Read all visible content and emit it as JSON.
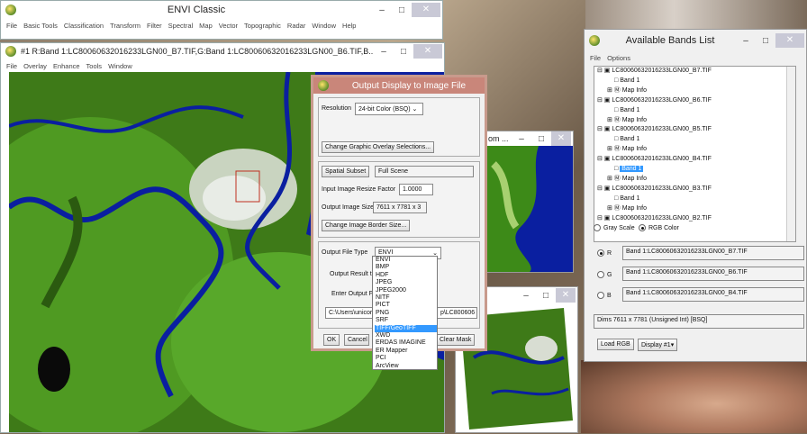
{
  "envi": {
    "title": "ENVI Classic",
    "menu": [
      "File",
      "Basic Tools",
      "Classification",
      "Transform",
      "Filter",
      "Spectral",
      "Map",
      "Vector",
      "Topographic",
      "Radar",
      "Window",
      "Help"
    ]
  },
  "display": {
    "title": "#1 R:Band 1:LC80060632016233LGN00_B7.TIF,G:Band 1:LC80060632016233LGN00_B6.TIF,B...",
    "menu": [
      "File",
      "Overlay",
      "Enhance",
      "Tools",
      "Window"
    ]
  },
  "dialog": {
    "title": "Output Display to Image File",
    "resolution_label": "Resolution",
    "resolution_value": "24-bit Color (BSQ)",
    "overlay_button": "Change Graphic Overlay Selections...",
    "spatial_subset_button": "Spatial Subset",
    "spatial_subset_value": "Full Scene",
    "resize_label": "Input Image Resize Factor",
    "resize_value": "1.0000",
    "size_label": "Output Image Size",
    "size_value": "7611 x 7781 x 3",
    "border_button": "Change Image Border Size...",
    "file_type_label": "Output File Type",
    "file_type_value": "ENVI",
    "output_result_label": "Output Result to",
    "enter_output_label": "Enter Output Fil",
    "path_left": "C:\\Users\\unicor",
    "path_right": "p\\LC800606",
    "ok": "OK",
    "cancel": "Cancel",
    "clear_mask": "Clear Mask",
    "file_types": [
      "ENVI",
      "BMP",
      "HDF",
      "JPEG",
      "JPEG2000",
      "NITF",
      "PICT",
      "PNG",
      "SRF",
      "TIFF/GeoTIFF",
      "XWD",
      "ERDAS IMAGINE",
      "ER Mapper",
      "PCI",
      "ArcView"
    ],
    "file_type_selected_index": 9
  },
  "zoom_window": {
    "title": "om ..."
  },
  "scroll_window": {
    "title": "roll (0..."
  },
  "bands": {
    "title": "Available Bands List",
    "menu": [
      "File",
      "Options"
    ],
    "tree": [
      {
        "file": "LC80060632016233LGN00_B7.TIF",
        "band": "Band 1",
        "info": "Map Info"
      },
      {
        "file": "LC80060632016233LGN00_B6.TIF",
        "band": "Band 1",
        "info": "Map Info"
      },
      {
        "file": "LC80060632016233LGN00_B5.TIF",
        "band": "Band 1",
        "info": "Map Info"
      },
      {
        "file": "LC80060632016233LGN00_B4.TIF",
        "band": "Band 1",
        "info": "Map Info"
      },
      {
        "file": "LC80060632016233LGN00_B3.TIF",
        "band": "Band 1",
        "info": "Map Info"
      }
    ],
    "tree_partial": "LC80060632016233LGN00_B2.TIF",
    "highlight_index": 3,
    "gray_scale": "Gray Scale",
    "rgb_color": "RGB Color",
    "r_label": "R",
    "g_label": "G",
    "b_label": "B",
    "r_value": "Band 1:LC80060632016233LGN00_B7.TIF",
    "g_value": "Band 1:LC80060632016233LGN00_B6.TIF",
    "b_value": "Band 1:LC80060632016233LGN00_B4.TIF",
    "dims_label": "Dims",
    "dims_value": "7611 x 7781 (Unsigned Int) [BSQ]",
    "load_rgb": "Load RGB",
    "display_btn": "Display #1"
  },
  "colors": {
    "dialog_title": "#c9867a",
    "highlight": "#3399ff",
    "water": "#0a1fa0",
    "vegetation": "#3f7a1a"
  }
}
